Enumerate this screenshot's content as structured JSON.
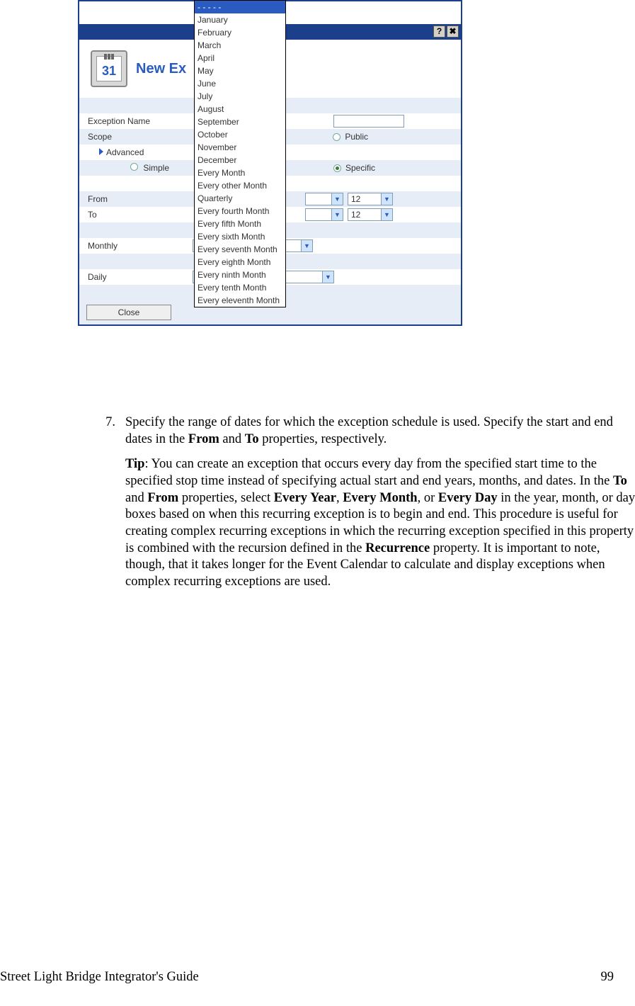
{
  "dialog": {
    "header_title": "New Ex",
    "calendar_day": "31",
    "rows": {
      "exception_name": "Exception Name",
      "scope": "Scope",
      "scope_public": "Public",
      "advanced": "Advanced",
      "simple": "Simple",
      "specific": "Specific",
      "from": "From",
      "to": "To",
      "from_val2": "12",
      "to_val2": "12",
      "monthly": "Monthly",
      "monthly_val": "- - - - -",
      "daily": "Daily",
      "daily_val": "- - - - -"
    },
    "close": "Close",
    "dropdown_options": [
      "- - - - -",
      "January",
      "February",
      "March",
      "April",
      "May",
      "June",
      "July",
      "August",
      "September",
      "October",
      "November",
      "December",
      "Every Month",
      "Every other Month",
      "Quarterly",
      "Every fourth Month",
      "Every fifth Month",
      "Every sixth Month",
      "Every seventh Month",
      "Every eighth Month",
      "Every ninth Month",
      "Every tenth Month",
      "Every eleventh Month"
    ]
  },
  "step": {
    "num": "7.",
    "para1_a": "Specify the range of dates for which the exception schedule is used. Specify the start and end dates in the ",
    "para1_b": "From",
    "para1_c": " and ",
    "para1_d": "To",
    "para1_e": " properties, respectively.",
    "tip_label": "Tip",
    "tip_a": ":  You can create an exception that occurs every day from the specified start time to the specified stop time instead of specifying actual start and end years, months, and dates.  In the ",
    "tip_b": "To",
    "tip_c": " and ",
    "tip_d": "From",
    "tip_e": " properties, select ",
    "tip_f": "Every Year",
    "tip_g": ", ",
    "tip_h": "Every Month",
    "tip_i": ", or ",
    "tip_j": "Every Day",
    "tip_k": " in the year, month, or day boxes based on when this recurring exception is to begin and end.  This procedure is useful for creating complex recurring exceptions in which the recurring exception specified in this property is combined with the recursion defined in the ",
    "tip_l": "Recurrence",
    "tip_m": " property.  It is important to note, though, that it takes longer for the Event Calendar to calculate and display exceptions when complex recurring exceptions are used."
  },
  "footer": {
    "left": "Street Light Bridge Integrator's Guide",
    "right": "99"
  }
}
